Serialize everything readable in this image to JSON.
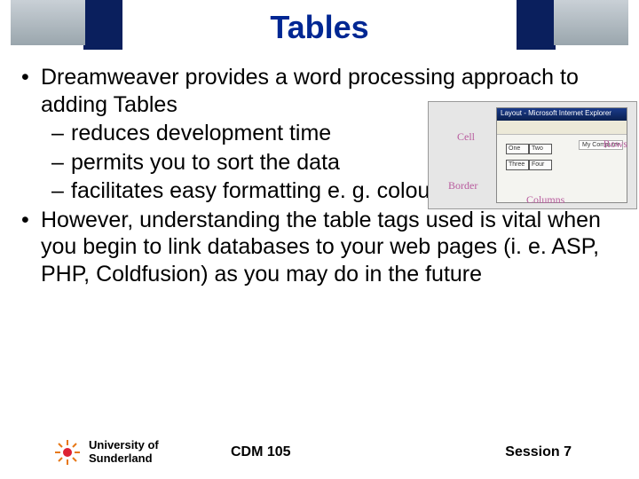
{
  "title": "Tables",
  "bullets": {
    "b1": "Dreamweaver provides a word processing approach to adding Tables",
    "s1": "reduces development time",
    "s2": "permits you to sort the data",
    "s3": "facilitates easy formatting e. g. colour and size",
    "b2": "However, understanding the table tags used is vital when you begin to link databases to your web pages (i. e. ASP, PHP, Coldfusion) as you may do in the future"
  },
  "graphic": {
    "winTitle": "Layout - Microsoft Internet Explorer",
    "labels": {
      "cell": "Cell",
      "rows": "Rows",
      "border": "Border",
      "columns": "Columns"
    },
    "cells": {
      "a1": "One",
      "a2": "Two",
      "b1": "Three",
      "b2": "Four"
    },
    "sidebar": "My Computer"
  },
  "footer": {
    "uni1": "University of",
    "uni2": "Sunderland",
    "course": "CDM 105",
    "session": "Session 7"
  }
}
